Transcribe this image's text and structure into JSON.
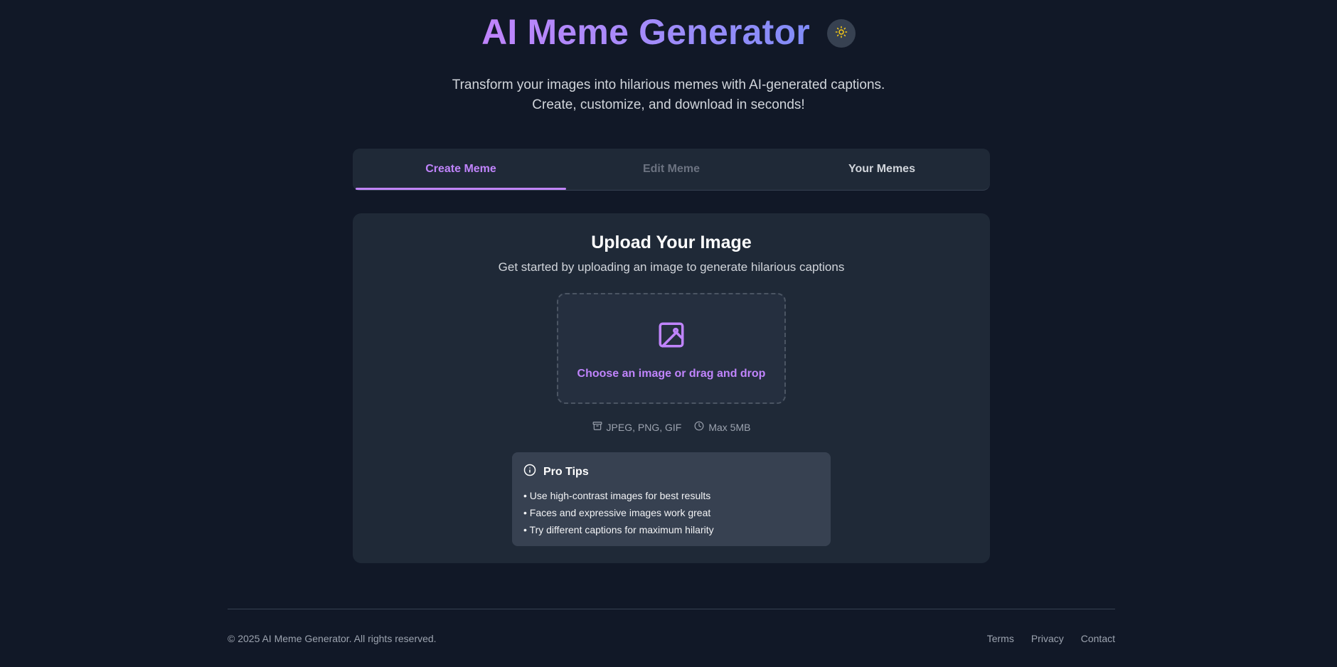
{
  "header": {
    "title": "AI Meme Generator",
    "theme_toggle_icon": "sun-icon",
    "subtitle": "Transform your images into hilarious memes with AI-generated captions. Create, customize, and download in seconds!"
  },
  "tabs": [
    {
      "label": "Create Meme",
      "state": "active"
    },
    {
      "label": "Edit Meme",
      "state": "disabled"
    },
    {
      "label": "Your Memes",
      "state": "normal"
    }
  ],
  "upload": {
    "title": "Upload Your Image",
    "subtitle": "Get started by uploading an image to generate hilarious captions",
    "dropzone_icon": "image-icon",
    "dropzone_label": "Choose an image or drag and drop",
    "formats_icon": "archive-icon",
    "formats": "JPEG, PNG, GIF",
    "max_size_icon": "clock-icon",
    "max_size": "Max 5MB"
  },
  "tips": {
    "icon": "info-icon",
    "title": "Pro Tips",
    "items": [
      "• Use high-contrast images for best results",
      "• Faces and expressive images work great",
      "• Try different captions for maximum hilarity"
    ]
  },
  "footer": {
    "copyright": "© 2025 AI Meme Generator. All rights reserved.",
    "links": [
      "Terms",
      "Privacy",
      "Contact"
    ]
  },
  "colors": {
    "background": "#111827",
    "card": "#1f2937",
    "accent": "#c084fc",
    "tips_bg": "#374151"
  }
}
